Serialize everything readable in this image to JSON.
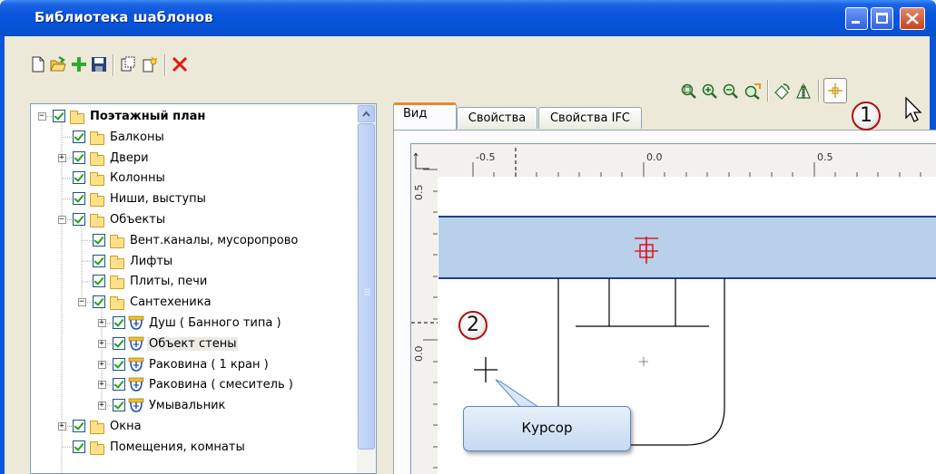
{
  "window": {
    "title": "Библиотека шаблонов"
  },
  "toolbar_left": {
    "icons": [
      "new-icon",
      "open-icon",
      "add-icon",
      "save-icon",
      "copy-icon",
      "paste-icon",
      "delete-icon"
    ]
  },
  "toolbar_right": {
    "icons": [
      "zoom-extents-icon",
      "zoom-in-icon",
      "zoom-out-icon",
      "zoom-all-icon",
      "rotate-icon",
      "mirror-icon",
      "base-point-icon"
    ]
  },
  "tree": {
    "items": [
      {
        "label": "Поэтажный план",
        "bold": true
      },
      {
        "label": "Балконы"
      },
      {
        "label": "Двери"
      },
      {
        "label": "Колонны"
      },
      {
        "label": "Ниши, выступы"
      },
      {
        "label": "Объекты"
      },
      {
        "label": "Вент.каналы, мусоропрово"
      },
      {
        "label": "Лифты"
      },
      {
        "label": "Плиты, печи"
      },
      {
        "label": "Сантехеника"
      },
      {
        "label": "Душ ( Банного типа )"
      },
      {
        "label": "Объект стены"
      },
      {
        "label": "Раковина ( 1 кран )"
      },
      {
        "label": "Раковина ( смеситель )"
      },
      {
        "label": "Умывальник"
      },
      {
        "label": "Окна"
      },
      {
        "label": "Помещения, комнаты"
      }
    ]
  },
  "tabs": [
    {
      "label": "Вид",
      "active": true
    },
    {
      "label": "Свойства"
    },
    {
      "label": "Свойства IFC"
    }
  ],
  "ruler": {
    "top_labels": [
      "-0.5",
      "0.0",
      "0.5"
    ],
    "left_labels": [
      "0.5",
      "0.0"
    ]
  },
  "annotations": {
    "callout_1": "1",
    "callout_2": "2",
    "tooltip": "Курсор"
  },
  "colors": {
    "titlebar": "#0a54dc",
    "wall_fill": "#b8d0ea",
    "wall_edge": "#1f3f8f",
    "base_point": "#e00000",
    "callout_border": "#b01010"
  }
}
